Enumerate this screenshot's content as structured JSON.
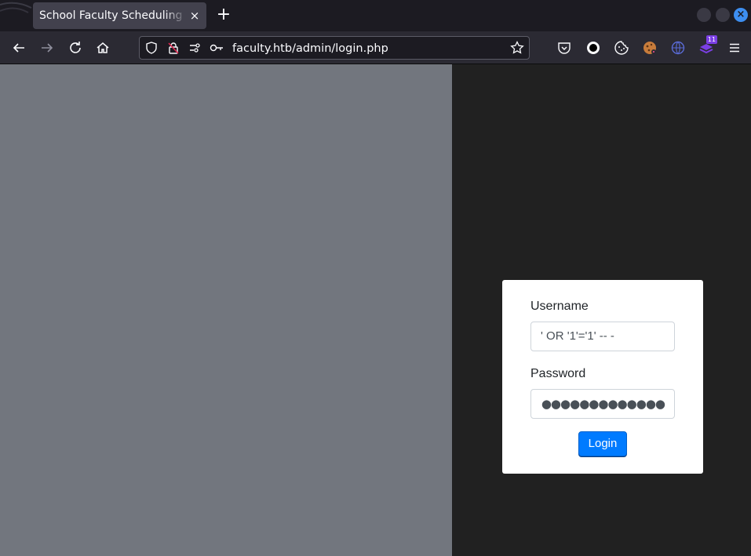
{
  "browser": {
    "tab": {
      "title": "School Faculty Scheduling System",
      "close_glyph": "×"
    },
    "new_tab_glyph": "+",
    "window_close_glyph": "×",
    "url": "faculty.htb/admin/login.php",
    "nav_icons": [
      "back-icon",
      "forward-icon",
      "reload-icon",
      "home-icon"
    ],
    "url_icons": [
      "shield-icon",
      "insecure-lock-icon",
      "permissions-icon",
      "key-icon",
      "bookmark-star-icon"
    ],
    "extension_icons": [
      "pocket-icon",
      "record-icon",
      "cookie-icon",
      "cookie-editor-icon",
      "globe-extension-icon",
      "hackbar-extension-icon",
      "menu-icon"
    ],
    "extension_badge": "11"
  },
  "colors": {
    "left_pane": "#72767e",
    "right_pane": "#212121",
    "accent": "#007bff"
  },
  "login": {
    "username_label": "Username",
    "username_value": "' OR '1'='1' -- -",
    "password_label": "Password",
    "password_mask": "●●●●●●●●●●●●●",
    "login_button": "Login"
  }
}
